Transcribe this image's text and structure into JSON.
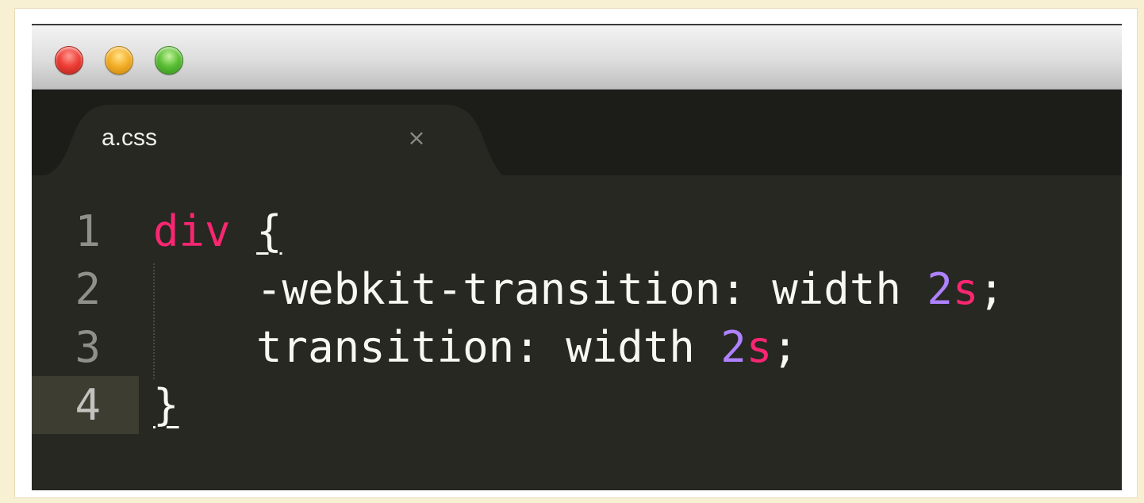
{
  "window": {
    "traffic_lights": [
      "close",
      "minimize",
      "zoom"
    ]
  },
  "tab": {
    "label": "a.css",
    "close_glyph": "×"
  },
  "editor": {
    "lines": [
      {
        "number": "1",
        "selector": "div",
        "open_brace": "{"
      },
      {
        "number": "2",
        "property": "-webkit-transition:",
        "value": "width",
        "num": "2",
        "unit": "s",
        "end": ";"
      },
      {
        "number": "3",
        "property": "transition:",
        "value": "width",
        "num": "2",
        "unit": "s",
        "end": ";"
      },
      {
        "number": "4",
        "close_brace": "}"
      }
    ],
    "active_line": 4
  },
  "colors": {
    "background": "#272822",
    "keyword": "#f92672",
    "number": "#ae81ff",
    "text": "#f8f8f2"
  }
}
